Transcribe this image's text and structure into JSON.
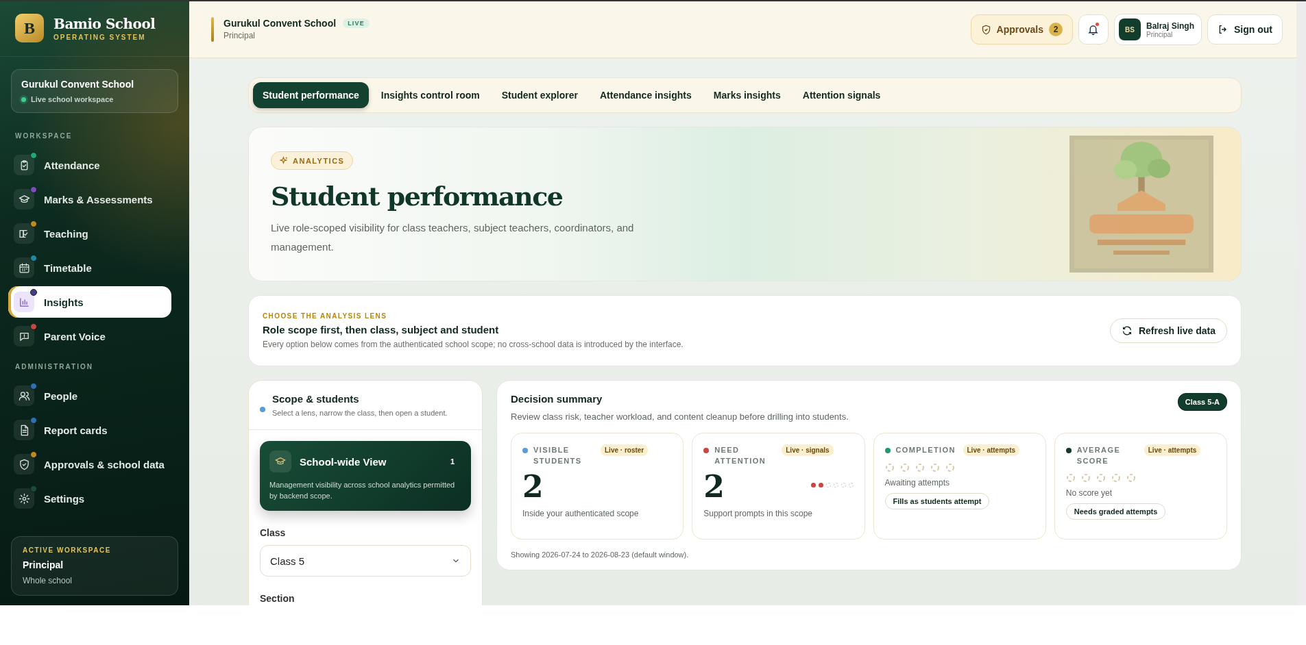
{
  "brand": {
    "initial": "B",
    "name": "Bamio School",
    "subtitle": "OPERATING SYSTEM"
  },
  "school_card": {
    "name": "Gurukul Convent School",
    "status": "Live school workspace"
  },
  "sidebar": {
    "sections": [
      {
        "label": "WORKSPACE",
        "items": [
          {
            "label": "Attendance",
            "color": "#1fa67a",
            "selected": false
          },
          {
            "label": "Marks & Assessments",
            "color": "#7c4dbd",
            "selected": false
          },
          {
            "label": "Teaching",
            "color": "#c08a1e",
            "selected": false
          },
          {
            "label": "Timetable",
            "color": "#1f87a0",
            "selected": false
          },
          {
            "label": "Insights",
            "color": "#4b3a8c",
            "selected": true
          },
          {
            "label": "Parent Voice",
            "color": "#c9473f",
            "selected": false
          }
        ]
      },
      {
        "label": "ADMINISTRATION",
        "items": [
          {
            "label": "People",
            "color": "#2f6fb0",
            "selected": false
          },
          {
            "label": "Report cards",
            "color": "#2f6fb0",
            "selected": false
          },
          {
            "label": "Approvals & school data",
            "color": "#c08a1e",
            "selected": false
          },
          {
            "label": "Settings",
            "color": "#1e4a3a",
            "selected": false
          }
        ]
      }
    ]
  },
  "active_workspace": {
    "label": "ACTIVE WORKSPACE",
    "role": "Principal",
    "scope": "Whole school"
  },
  "header": {
    "school": "Gurukul Convent School",
    "badge": "LIVE",
    "role": "Principal"
  },
  "approvals": {
    "label": "Approvals",
    "count": "2"
  },
  "notifications": {
    "unread": true
  },
  "user": {
    "initials": "BS",
    "name": "Balraj Singh",
    "role": "Principal"
  },
  "sign_out": "Sign out",
  "tabs": [
    {
      "label": "Student performance",
      "selected": true
    },
    {
      "label": "Insights control room",
      "selected": false
    },
    {
      "label": "Student explorer",
      "selected": false
    },
    {
      "label": "Attendance insights",
      "selected": false
    },
    {
      "label": "Marks insights",
      "selected": false
    },
    {
      "label": "Attention signals",
      "selected": false
    }
  ],
  "hero": {
    "badge": "ANALYTICS",
    "title": "Student performance",
    "description": "Live role-scoped visibility for class teachers, subject teachers, coordinators, and management."
  },
  "lens": {
    "eyebrow": "CHOOSE THE ANALYSIS LENS",
    "title": "Role scope first, then class, subject and student",
    "description": "Every option below comes from the authenticated school scope; no cross-school data is introduced by the interface.",
    "button": "Refresh live data"
  },
  "scope": {
    "title": "Scope & students",
    "description": "Select a lens, narrow the class, then open a student.",
    "lens_card": {
      "title": "School-wide View",
      "count": "1",
      "description": "Management visibility across school analytics permitted by backend scope.",
      "selected": true
    },
    "class_label": "Class",
    "class_value": "Class 5",
    "section_label": "Section"
  },
  "summary": {
    "title": "Decision summary",
    "description": "Review class risk, teacher workload, and content cleanup before drilling into students.",
    "badge": "Class 5-A",
    "metrics": [
      {
        "kind": "number",
        "label": "VISIBLE STUDENTS",
        "color": "#5b9bd8",
        "tag": "Live · roster",
        "value": "2",
        "caption": "Inside your authenticated scope"
      },
      {
        "kind": "number",
        "label": "NEED ATTENTION",
        "color": "#c9473f",
        "tag": "Live · signals",
        "value": "2",
        "caption": "Support prompts in this scope",
        "dots": [
          {
            "filled": true
          },
          {
            "filled": true
          },
          {
            "filled": false
          },
          {
            "filled": false
          },
          {
            "filled": false
          },
          {
            "filled": false
          }
        ]
      },
      {
        "kind": "pending",
        "label": "COMPLETION",
        "color": "#1f9a6f",
        "tag": "Live · attempts",
        "caption": "Awaiting attempts",
        "chip": "Fills as students attempt"
      },
      {
        "kind": "pending",
        "label": "AVERAGE SCORE",
        "color": "#143a2c",
        "tag": "Live · attempts",
        "caption": "No score yet",
        "chip": "Needs graded attempts"
      }
    ],
    "footer": "Showing 2026-07-24 to 2026-08-23 (default window)."
  }
}
